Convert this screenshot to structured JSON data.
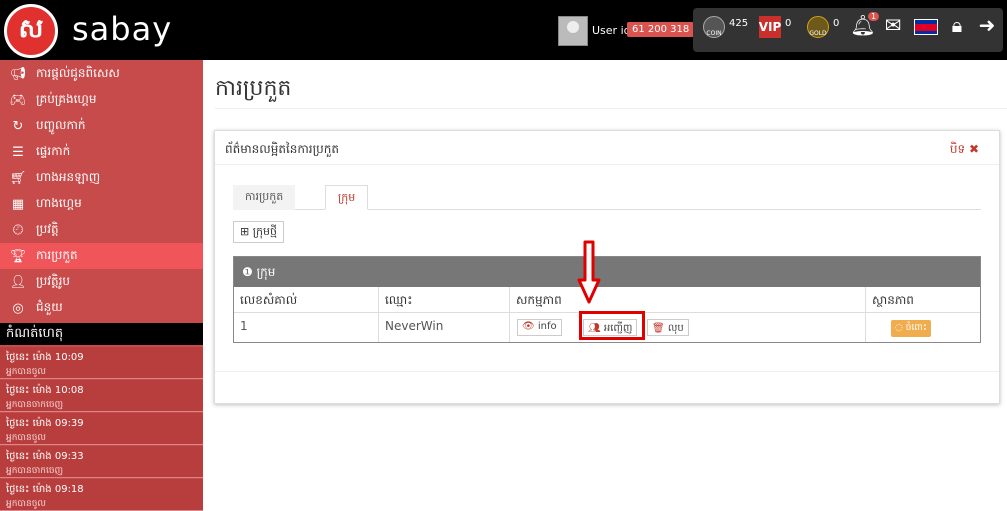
{
  "header": {
    "logo_glyph": "ស",
    "logo_text": "sabay",
    "user_id_label": "User id",
    "user_id": "61 200 318",
    "coin_label": "COIN",
    "coin_value": "425",
    "vip_label": "VIP",
    "vip_value": "0",
    "gold_label": "GOLD",
    "gold_value": "0",
    "notification_count": "1",
    "icons": [
      "bell-icon",
      "mail-icon",
      "cambodia-flag-icon",
      "lock-icon",
      "logout-icon"
    ]
  },
  "sidebar": {
    "items": [
      {
        "label": "ការផ្តល់ជូនពិសេស",
        "icon": "megaphone-icon"
      },
      {
        "label": "គ្រប់គ្រងហ្គេម",
        "icon": "gamepad-icon"
      },
      {
        "label": "បញ្ចូលកាក់",
        "icon": "refresh-icon"
      },
      {
        "label": "ផ្ទេរកាក់",
        "icon": "coins-icon"
      },
      {
        "label": "ហាងអនឡាញ",
        "icon": "cart-icon"
      },
      {
        "label": "ហាងហ្គេម",
        "icon": "chess-icon"
      },
      {
        "label": "ប្រវត្តិ",
        "icon": "clock-icon"
      },
      {
        "label": "ការប្រកួត",
        "icon": "trophy-icon",
        "active": true
      },
      {
        "label": "ប្រវត្តិរូប",
        "icon": "user-icon"
      },
      {
        "label": "ជំនួយ",
        "icon": "lifebuoy-icon"
      }
    ],
    "section_title": "កំណត់ហេតុ",
    "news": [
      {
        "time": "ថ្ងៃនេះ ម៉ោង 10:09",
        "text": "អ្នកបានចូល"
      },
      {
        "time": "ថ្ងៃនេះ ម៉ោង 10:08",
        "text": "អ្នកបានចាកចេញ"
      },
      {
        "time": "ថ្ងៃនេះ ម៉ោង 09:39",
        "text": "អ្នកបានចូល"
      },
      {
        "time": "ថ្ងៃនេះ ម៉ោង 09:33",
        "text": "អ្នកបានចាកចេញ"
      },
      {
        "time": "ថ្ងៃនេះ ម៉ោង 09:18",
        "text": "អ្នកបានចូល"
      }
    ]
  },
  "main": {
    "page_title": "ការប្រកួត",
    "panel_title": "ព័ត៌មានលម្អិតនៃការប្រកួត",
    "close_label": "បិទ ✖",
    "tabs": [
      {
        "label": "ការប្រកួត"
      },
      {
        "label": "ក្រុម"
      }
    ],
    "new_team_label": "⊞ ក្រុមថ្មី",
    "table": {
      "title": "❶ ក្រុម",
      "columns": [
        "លេខសំគាល់",
        "ឈ្មោះ",
        "សកម្មភាព",
        "ស្ថានភាព"
      ],
      "rows": [
        {
          "id": "1",
          "name": "NeverWin",
          "actions": [
            "info",
            "អញ្ជើញ",
            "លុប"
          ],
          "status": "ចំពោះ"
        }
      ]
    }
  },
  "colors": {
    "sidebar_bg": "#c74b4b",
    "active_item": "#f0555a",
    "highlight": "#e00000",
    "status_badge": "#f0ad4e"
  }
}
